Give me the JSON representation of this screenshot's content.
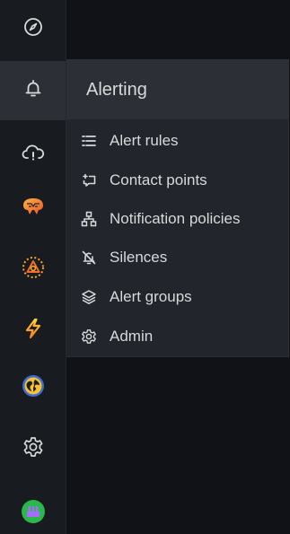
{
  "sidebar": {
    "items": [
      {
        "name": "explore-icon"
      },
      {
        "name": "alerting-bell-icon",
        "active": true
      },
      {
        "name": "cloud-alert-icon"
      },
      {
        "name": "brain-icon"
      },
      {
        "name": "oncall-icon"
      },
      {
        "name": "lightning-icon"
      },
      {
        "name": "globe-icon"
      },
      {
        "name": "gear-icon"
      },
      {
        "name": "plugin-avatar-icon"
      }
    ]
  },
  "flyout": {
    "title": "Alerting",
    "items": [
      {
        "label": "Alert rules",
        "icon": "list-icon"
      },
      {
        "label": "Contact points",
        "icon": "comment-icon"
      },
      {
        "label": "Notification policies",
        "icon": "sitemap-icon"
      },
      {
        "label": "Silences",
        "icon": "bell-slash-icon"
      },
      {
        "label": "Alert groups",
        "icon": "layer-group-icon"
      },
      {
        "label": "Admin",
        "icon": "cog-icon"
      }
    ]
  },
  "colors": {
    "rail_bg": "#181b1f",
    "flyout_bg": "#22252b",
    "active_bg": "#2c2f36",
    "text": "#d8d9da",
    "orange": "#f5a623",
    "yellow": "#fbc02d",
    "green": "#2ab84b",
    "purple": "#a56cff"
  }
}
